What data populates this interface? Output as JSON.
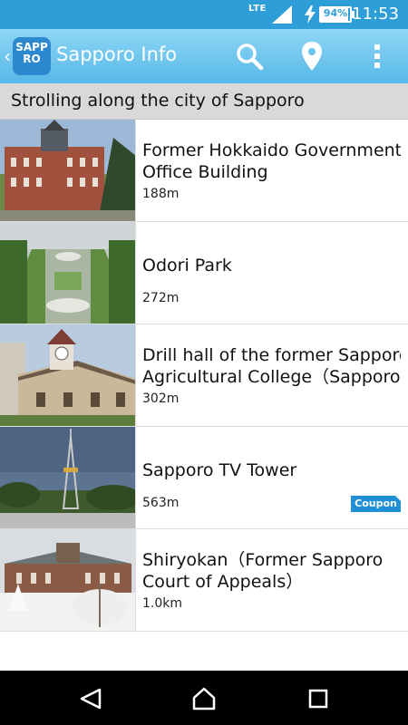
{
  "status_bar": {
    "network": "LTE",
    "battery_percent": 94,
    "battery_label": "94%",
    "time": "11:53"
  },
  "app_bar": {
    "logo_line1": "SAPP",
    "logo_line2": "RO",
    "title": "Sapporo Info",
    "icons": [
      "search-icon",
      "location-pin-icon",
      "overflow-menu-icon"
    ]
  },
  "section": {
    "title": "Strolling along the city of Sapporo"
  },
  "places": [
    {
      "name_line1": "Former Hokkaido Government",
      "name_line2": "Office Building",
      "distance": "188m"
    },
    {
      "name_line1": "Odori Park",
      "name_line2": "",
      "distance": "272m"
    },
    {
      "name_line1": "Drill hall of the former Sapporo",
      "name_line2": "Agricultural College（Sapporo",
      "distance": "302m"
    },
    {
      "name_line1": "Sapporo TV Tower",
      "name_line2": "",
      "distance": "563m",
      "badge": "Coupon"
    },
    {
      "name_line1": "Shiryokan（Former Sapporo",
      "name_line2": "Court of Appeals）",
      "distance": "1.0km"
    }
  ],
  "colors": {
    "status_bar": "#2e9ed9",
    "app_bar_top": "#8ed6f5",
    "app_bar_bottom": "#57b8e8",
    "coupon": "#1f8fd6"
  }
}
